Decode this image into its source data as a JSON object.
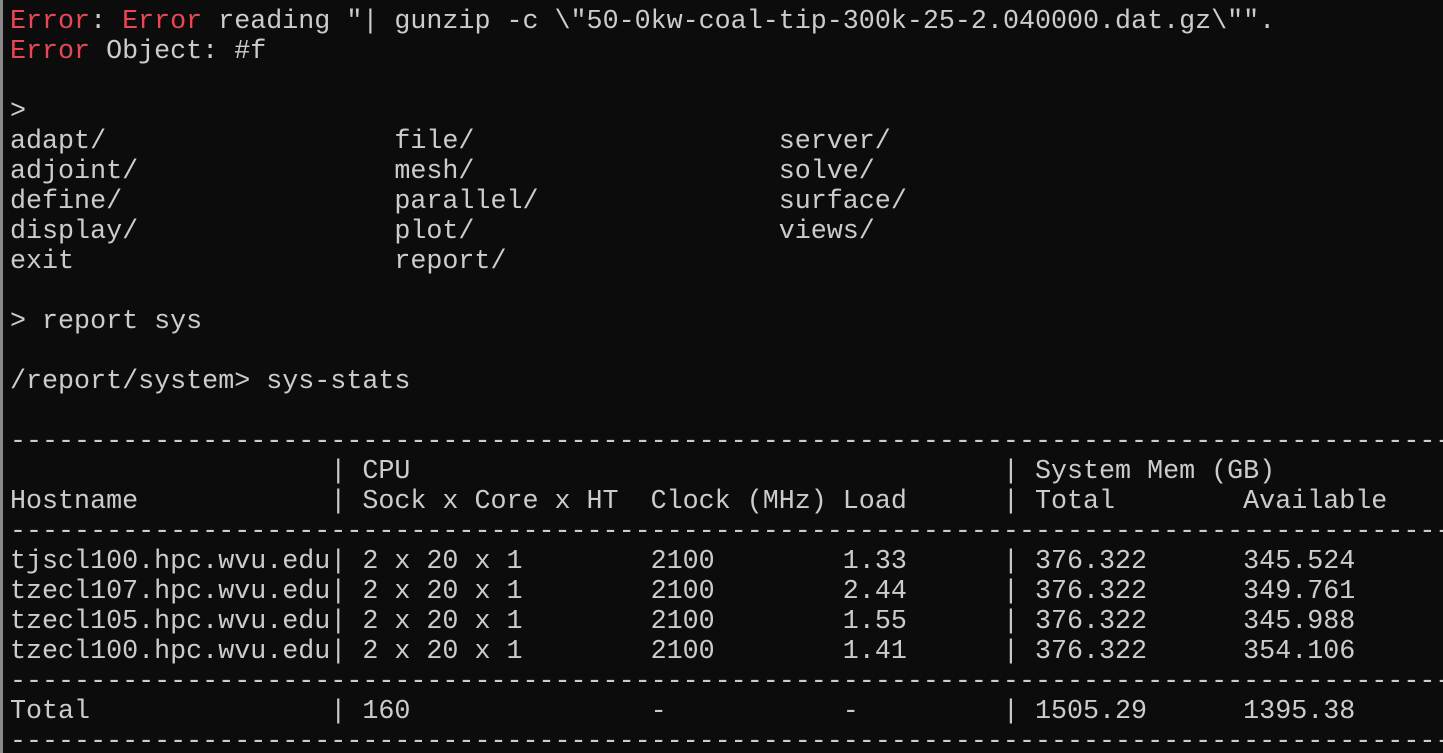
{
  "error": {
    "word1": "Error",
    "colon": ": ",
    "word2": "Error",
    "message": " reading \"| gunzip -c \\\"50-0kw-coal-tip-300k-25-2.040000.dat.gz\\\"\".",
    "obj_word": "Error",
    "obj_rest": " Object: #f"
  },
  "prompt1": ">",
  "menu": {
    "rows": [
      [
        "adapt/",
        "file/",
        "server/"
      ],
      [
        "adjoint/",
        "mesh/",
        "solve/"
      ],
      [
        "define/",
        "parallel/",
        "surface/"
      ],
      [
        "display/",
        "plot/",
        "views/"
      ],
      [
        "exit",
        "report/",
        ""
      ]
    ]
  },
  "cmd1": "> report sys",
  "cmd2": "/report/system> sys-stats",
  "separator": "-------------------------------------------------------------------------------------------",
  "table": {
    "header1": "                    | CPU                                     | System Mem (GB)",
    "header2": "Hostname            | Sock x Core x HT  Clock (MHz) Load      | Total        Available",
    "rows": [
      "tjscl100.hpc.wvu.edu| 2 x 20 x 1        2100        1.33      | 376.322      345.524",
      "tzecl107.hpc.wvu.edu| 2 x 20 x 1        2100        2.44      | 376.322      349.761",
      "tzecl105.hpc.wvu.edu| 2 x 20 x 1        2100        1.55      | 376.322      345.988",
      "tzecl100.hpc.wvu.edu| 2 x 20 x 1        2100        1.41      | 376.322      354.106"
    ],
    "total": "Total               | 160               -           -         | 1505.29      1395.38"
  },
  "colors": {
    "background": "#0c0c0c",
    "text": "#cccccc",
    "error": "#e74856"
  }
}
